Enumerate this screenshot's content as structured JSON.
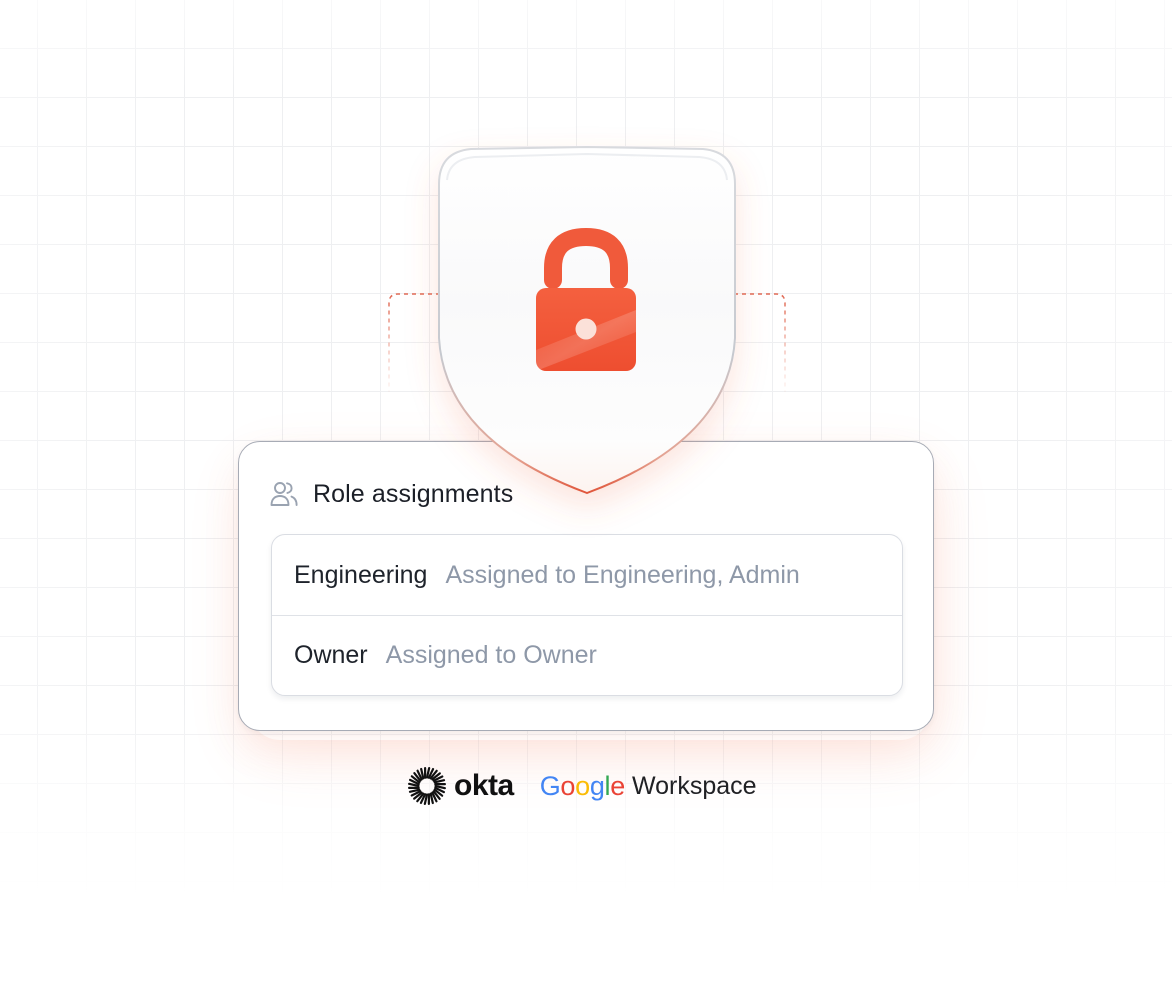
{
  "card": {
    "title": "Role assignments",
    "rows": [
      {
        "name": "Engineering",
        "description": "Assigned to Engineering, Admin"
      },
      {
        "name": "Owner",
        "description": "Assigned to Owner"
      }
    ]
  },
  "integrations": {
    "okta": "okta",
    "google_letters": [
      "G",
      "o",
      "o",
      "g",
      "l",
      "e"
    ],
    "workspace": "Workspace"
  },
  "icons": {
    "shield": "shield-icon",
    "lock": "lock-icon",
    "users": "users-icon",
    "okta": "okta-logo-icon"
  },
  "colors": {
    "accent": "#f0573a",
    "lock_top": "#f4603f",
    "lock_bottom": "#ee4e30",
    "text_primary": "#1e232b",
    "text_secondary": "#8e98a8",
    "google_blue": "#4285f4",
    "google_red": "#ea4335",
    "google_yellow": "#fbbc05",
    "google_green": "#34a853"
  }
}
